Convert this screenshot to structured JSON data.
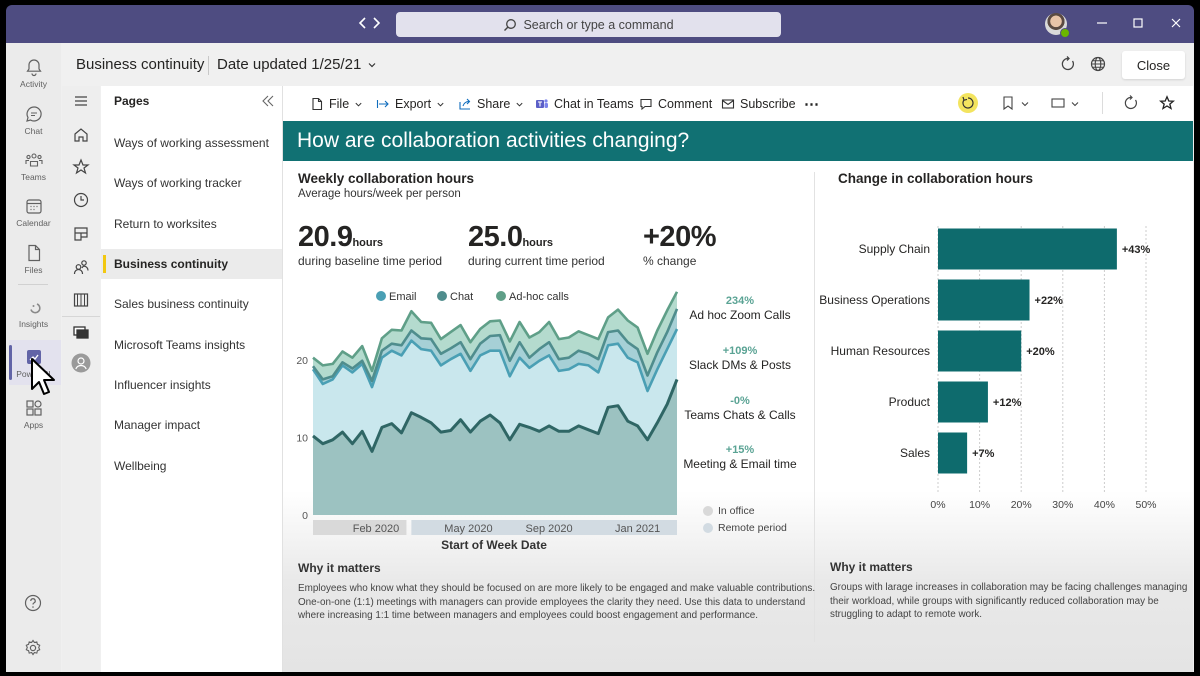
{
  "titlebar": {
    "search_placeholder": "Search or type a command"
  },
  "teams_rail": {
    "items": [
      {
        "label": "Activity",
        "icon": "bell-icon"
      },
      {
        "label": "Chat",
        "icon": "chat-icon"
      },
      {
        "label": "Teams",
        "icon": "teams-icon"
      },
      {
        "label": "Calendar",
        "icon": "calendar-icon"
      },
      {
        "label": "Files",
        "icon": "file-icon"
      },
      {
        "label": "Insights",
        "icon": "insights-icon"
      },
      {
        "label": "Power BI",
        "icon": "power-bi-icon",
        "active": true
      },
      {
        "label": "Apps",
        "icon": "apps-icon"
      }
    ],
    "bottom_icons": [
      "help-icon",
      "settings-icon"
    ]
  },
  "header": {
    "title": "Business continuity",
    "date": "Date updated 1/25/21",
    "close": "Close"
  },
  "pages": {
    "title": "Pages",
    "active_index": 3,
    "items": [
      {
        "label": "Ways of working assessment"
      },
      {
        "label": "Ways of working tracker"
      },
      {
        "label": "Return to worksites"
      },
      {
        "label": "Business continuity"
      },
      {
        "label": "Sales business continuity"
      },
      {
        "label": "Microsoft Teams insights"
      },
      {
        "label": "Influencer insights"
      },
      {
        "label": "Manager impact"
      },
      {
        "label": "Wellbeing"
      }
    ]
  },
  "toolbar": {
    "file": "File",
    "export": "Export",
    "share": "Share",
    "chat_in_teams": "Chat in Teams",
    "comment": "Comment",
    "subscribe": "Subscribe",
    "more": "⋯"
  },
  "colors": {
    "header_band": "#117173",
    "bar": "#0e6b6d",
    "teams_purple": "#6264a7",
    "active_page_marker": "#f2c811",
    "annotation_change": "#5aa394"
  },
  "report": {
    "heading": "How are collaboration activities changing?",
    "left": {
      "title": "Weekly collaboration hours",
      "subtitle": "Average hours/week per person",
      "kpis": [
        {
          "value": "20.9",
          "unit": "hours",
          "caption": "during baseline time period"
        },
        {
          "value": "25.0",
          "unit": "hours",
          "caption": "during current time period"
        },
        {
          "value": "+20%",
          "unit": "",
          "caption": "% change"
        }
      ],
      "annotations": [
        {
          "change": "234%",
          "label": "Ad hoc Zoom Calls"
        },
        {
          "change": "+109%",
          "label": "Slack DMs & Posts"
        },
        {
          "change": "-0%",
          "label": "Teams Chats & Calls"
        },
        {
          "change": "+15%",
          "label": "Meeting & Email time"
        }
      ],
      "period_legend": [
        {
          "label": "In office",
          "color": "#d9d9d9"
        },
        {
          "label": "Remote period",
          "color": "#d2dbe2"
        }
      ],
      "why_title": "Why it matters",
      "why_lines": [
        "Employees who know what they should be focused on are more likely to be engaged and make valuable contributions.",
        "One-on-one (1:1) meetings with managers can provide employees the clarity they need. Use this data to understand",
        "where increasing 1:1 time between managers and employees could boost engagement and performance."
      ]
    },
    "right": {
      "title": "Change in collaboration hours",
      "why_title": "Why it matters",
      "why_lines": [
        "Groups with larage increases in collaboration may be facing challenges managing",
        "their workload, while groups with significantly reduced collaboration may be",
        "struggling to adapt to remote work."
      ]
    }
  },
  "chart_data": [
    {
      "type": "area",
      "stacked": true,
      "title": "Weekly collaboration hours",
      "xlabel": "Start of Week Date",
      "ylabel": "",
      "ylim": [
        0,
        29
      ],
      "yticks": [
        0,
        10,
        20
      ],
      "x_count": 38,
      "xticks": [
        {
          "label": "Feb 2020",
          "at": 6.4
        },
        {
          "label": "May 2020",
          "at": 15.8
        },
        {
          "label": "Sep 2020",
          "at": 24
        },
        {
          "label": "Jan 2021",
          "at": 33
        }
      ],
      "periods": [
        {
          "label": "In office",
          "from": 0,
          "to": 9.5,
          "color": "#d9d9d9"
        },
        {
          "label": "Remote period",
          "from": 10,
          "to": 37,
          "color": "#d2dbe2"
        }
      ],
      "legend_position": "top",
      "grid": false,
      "series": [
        {
          "name": "",
          "in_legend": false,
          "line": "#2f6665",
          "fill": "#9cc2c1",
          "values": [
            10.2,
            9.2,
            9.7,
            10.7,
            9.2,
            10.8,
            8.2,
            11.3,
            11.8,
            10.6,
            13.2,
            12.6,
            11.9,
            10.7,
            10.9,
            12.3,
            10.7,
            12.1,
            12.9,
            11.9,
            9.7,
            11.7,
            11.3,
            10.8,
            11.5,
            10.8,
            10.8,
            11.5,
            11.0,
            10.5,
            13.9,
            14.1,
            12.1,
            11.5,
            9.7,
            11.9,
            14.3,
            17.5
          ]
        },
        {
          "name": "Email",
          "in_legend": true,
          "line": "#4a9fb4",
          "fill": "#c9e7ed",
          "values": [
            8.6,
            7.7,
            7.8,
            8.6,
            9.2,
            8.7,
            8.3,
            9.0,
            9.4,
            10.0,
            9.3,
            8.8,
            9.3,
            8.6,
            9.2,
            8.5,
            7.9,
            8.5,
            8.3,
            9.3,
            8.2,
            8.6,
            7.7,
            9.1,
            9.1,
            7.8,
            8.0,
            8.0,
            8.3,
            7.9,
            8.0,
            8.0,
            8.2,
            8.2,
            6.3,
            6.9,
            7.1,
            6.5
          ]
        },
        {
          "name": "Chat",
          "in_legend": true,
          "line": "#4f8d8d",
          "fill": "#a6d0d6",
          "values": [
            0.4,
            0.6,
            0.4,
            0.4,
            0.5,
            0.4,
            0.8,
            0.9,
            0.9,
            1.3,
            1.3,
            1.4,
            1.5,
            1.5,
            1.4,
            1.5,
            1.5,
            1.5,
            1.9,
            2.0,
            2.0,
            2.0,
            1.3,
            1.5,
            1.7,
            1.5,
            1.5,
            1.7,
            1.5,
            1.7,
            1.7,
            1.7,
            2.0,
            1.7,
            2.0,
            2.2,
            2.2,
            2.6
          ]
        },
        {
          "name": "Ad-hoc calls",
          "in_legend": true,
          "line": "#5f9f88",
          "fill": "#b4dbce",
          "values": [
            1.1,
            1.8,
            1.6,
            1.4,
            1.4,
            1.9,
            1.3,
            1.6,
            1.8,
            1.9,
            2.5,
            2.1,
            2.1,
            1.9,
            2.1,
            2.2,
            2.2,
            1.9,
            1.9,
            1.9,
            2.5,
            2.6,
            2.6,
            2.2,
            2.6,
            2.6,
            2.6,
            2.5,
            2.4,
            2.6,
            1.9,
            2.7,
            2.8,
            2.8,
            2.8,
            2.8,
            2.8,
            2.2
          ]
        }
      ]
    },
    {
      "type": "bar",
      "orientation": "horizontal",
      "title": "Change in collaboration hours",
      "categories": [
        "Supply Chain",
        "Business Operations",
        "Human Resources",
        "Product",
        "Sales"
      ],
      "values": [
        43,
        22,
        20,
        12,
        7
      ],
      "value_labels": [
        "+43%",
        "+22%",
        "+20%",
        "+12%",
        "+7%"
      ],
      "xlim": [
        0,
        50
      ],
      "xtick_values": [
        0,
        10,
        20,
        30,
        40,
        50
      ],
      "xtick_labels": [
        "0%",
        "10%",
        "20%",
        "30%",
        "40%",
        "50%"
      ],
      "xlabel": "",
      "ylabel": "",
      "grid": true
    }
  ]
}
